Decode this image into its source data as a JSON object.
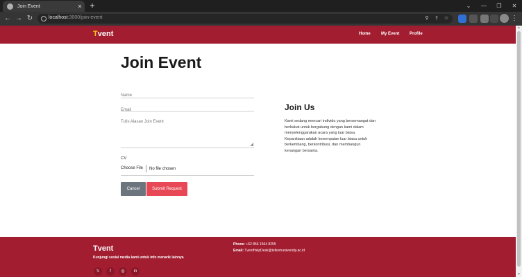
{
  "browser": {
    "tab_title": "Join Event",
    "tab_close": "✕",
    "new_tab": "+",
    "url_host": "localhost",
    "url_path": ":3000/join-event",
    "window_controls": [
      "⌄",
      "—",
      "❐",
      "✕"
    ]
  },
  "navbar": {
    "brand_first": "T",
    "brand_rest": "vent",
    "links": [
      "Home",
      "My Event",
      "Profile"
    ]
  },
  "form": {
    "title": "Join Event",
    "name_placeholder": "Name",
    "email_placeholder": "Email",
    "reason_placeholder": "Tulis Alasan Join Event",
    "cv_label": "CV",
    "file_button": "Choose File",
    "file_status": "No file chosen",
    "cancel_label": "Cancel",
    "submit_label": "Submit Request"
  },
  "aside": {
    "title": "Join Us",
    "text": "Kami sedang mencari individu yang bersemangat dan berbakat untuk bergabung dengan kami dalam menyelenggarakan acara yang luar biasa. Kepanitiaan adalah kesempatan luar biasa untuk berkembang, berkontribusi, dan membangun kenangan bersama."
  },
  "footer": {
    "brand": "Tvent",
    "tagline": "Kunjungi sosial media kami untuk info menarik lainnya",
    "phone_label": "Phone:",
    "phone_value": "+62 856 1564 8255",
    "email_label": "Email:",
    "email_value": "TventHelpDesk@telkomuniversity.ac.id",
    "social_icons": [
      "x-icon",
      "facebook-icon",
      "instagram-icon",
      "linkedin-icon"
    ]
  },
  "colors": {
    "brand_red": "#a31d31",
    "brand_yellow": "#f5c518",
    "submit": "#e84855",
    "cancel": "#6c757d"
  }
}
